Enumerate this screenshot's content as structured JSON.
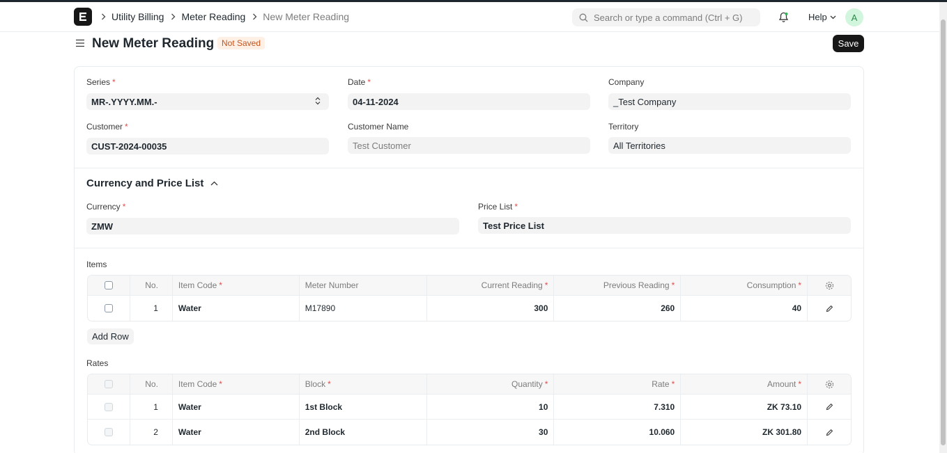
{
  "nav": {
    "breadcrumbs": [
      "Utility Billing",
      "Meter Reading",
      "New Meter Reading"
    ],
    "search_placeholder": "Search or type a command (Ctrl + G)",
    "help_label": "Help",
    "avatar_initial": "A"
  },
  "page": {
    "title": "New Meter Reading",
    "status": "Not Saved",
    "save_label": "Save"
  },
  "form": {
    "series": {
      "label": "Series",
      "value": "MR-.YYYY.MM.-"
    },
    "date": {
      "label": "Date",
      "value": "04-11-2024"
    },
    "company": {
      "label": "Company",
      "value": "_Test Company"
    },
    "customer": {
      "label": "Customer",
      "value": "CUST-2024-00035"
    },
    "customer_name": {
      "label": "Customer Name",
      "value": "Test Customer"
    },
    "territory": {
      "label": "Territory",
      "value": "All Territories"
    },
    "section_title": "Currency and Price List",
    "currency": {
      "label": "Currency",
      "value": "ZMW"
    },
    "price_list": {
      "label": "Price List",
      "value": "Test Price List"
    }
  },
  "items": {
    "label": "Items",
    "columns": [
      "No.",
      "Item Code",
      "Meter Number",
      "Current Reading",
      "Previous Reading",
      "Consumption"
    ],
    "rows": [
      {
        "no": "1",
        "item_code": "Water",
        "meter_number": "M17890",
        "current_reading": "300",
        "previous_reading": "260",
        "consumption": "40"
      }
    ],
    "add_row_label": "Add Row"
  },
  "rates": {
    "label": "Rates",
    "columns": [
      "No.",
      "Item Code",
      "Block",
      "Quantity",
      "Rate",
      "Amount"
    ],
    "rows": [
      {
        "no": "1",
        "item_code": "Water",
        "block": "1st Block",
        "quantity": "10",
        "rate": "7.310",
        "amount": "ZK 73.10"
      },
      {
        "no": "2",
        "item_code": "Water",
        "block": "2nd Block",
        "quantity": "30",
        "rate": "10.060",
        "amount": "ZK 301.80"
      }
    ]
  },
  "colors": {
    "primary": "#171717",
    "badge_bg": "#fff0e5",
    "badge_text": "#c4561f",
    "required": "#e24c4c"
  }
}
